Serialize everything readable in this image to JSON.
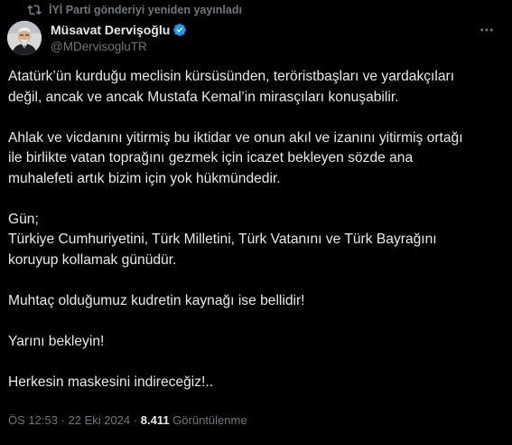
{
  "repost": {
    "icon": "repost-icon",
    "text": "İYİ Parti gönderiyi yeniden yayınladı"
  },
  "author": {
    "display_name": "Müsavat Dervişoğlu",
    "handle": "@MDervisogluTR",
    "verified_icon": "verified-badge-icon",
    "verified_color": "#1d9bf0"
  },
  "more_icon": "more-options-icon",
  "tweet": {
    "lines": [
      "Atatürk’ün kurduğu meclisin kürsüsünden, teröristbaşları ve yardakçıları",
      "değil, ancak ve ancak Mustafa Kemal’in mirasçıları konuşabilir.",
      "",
      "Ahlak ve vicdanını yitirmiş bu iktidar ve onun akıl ve izanını yitirmiş ortağı",
      "ile birlikte vatan toprağını gezmek için icazet bekleyen sözde ana",
      "muhalefeti artık bizim için yok hükmündedir.",
      "",
      "Gün;",
      "Türkiye Cumhuriyetini, Türk Milletini, Türk Vatanını ve Türk Bayrağını",
      "koruyup kollamak günüdür.",
      "",
      "Muhtaç olduğumuz kudretin kaynağı ise bellidir!",
      "",
      "Yarını bekleyin!",
      "",
      "Herkesin maskesini indireceğiz!.."
    ]
  },
  "meta": {
    "time": "ÖS 12:53",
    "separator": " · ",
    "date": "22 Eki 2024",
    "views_count": "8.411",
    "views_label": "Görüntülenme"
  },
  "colors": {
    "background": "#000000",
    "text": "#e7e9ea",
    "muted": "#71767b"
  }
}
